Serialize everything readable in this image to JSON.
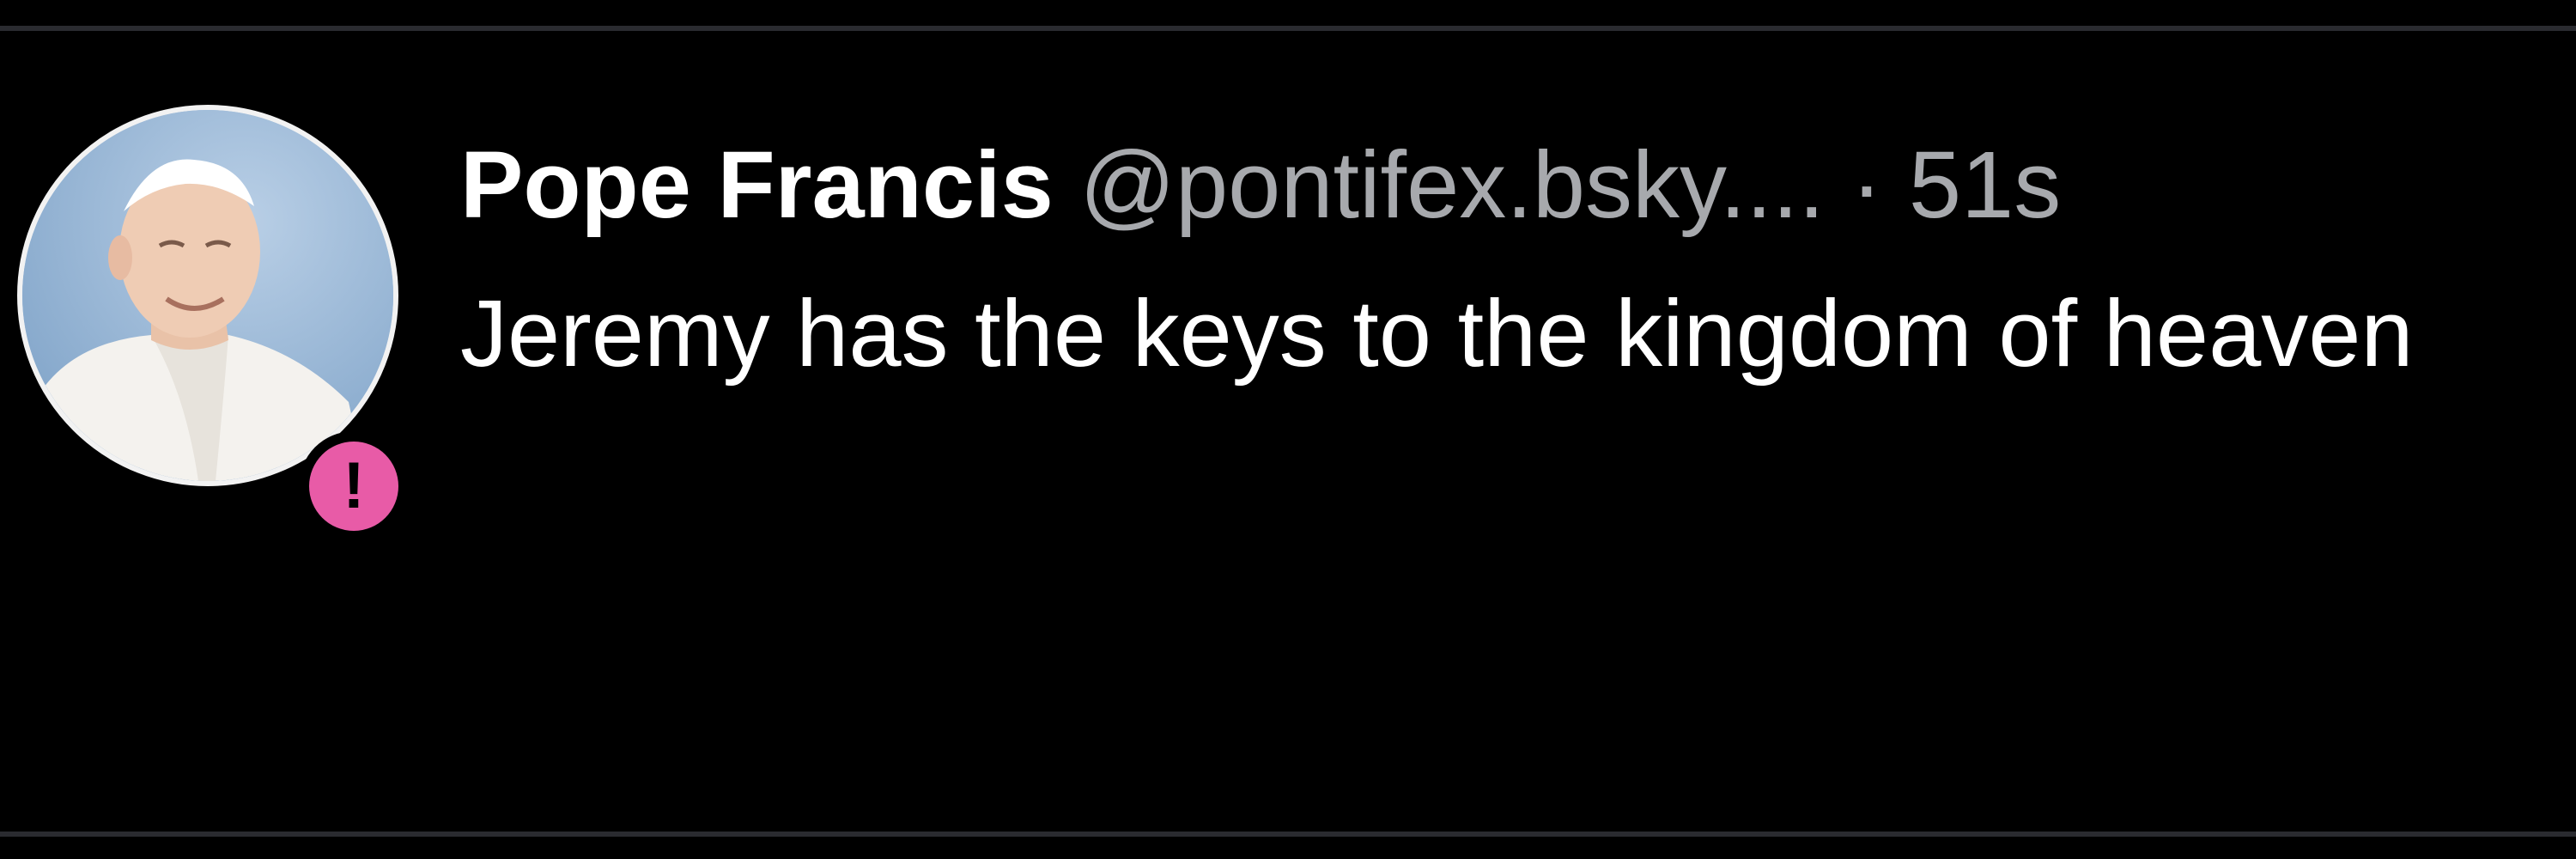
{
  "post": {
    "author": {
      "display_name": "Pope Francis",
      "handle": "@pontifex.bsky....",
      "avatar_icon": "profile-photo",
      "alert_badge": "!"
    },
    "separator": "·",
    "timestamp": "51s",
    "text": "Jeremy has the keys to the kingdom of heaven"
  },
  "colors": {
    "background": "#000000",
    "primary_text": "#ffffff",
    "secondary_text": "#a7a9ad",
    "badge": "#e85ba7",
    "divider": "#2a2b30"
  }
}
